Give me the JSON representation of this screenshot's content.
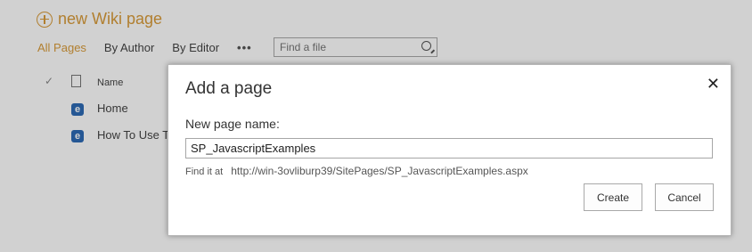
{
  "background": {
    "new_page_label": "new Wiki page",
    "tabs": [
      "All Pages",
      "By Author",
      "By Editor"
    ],
    "more_label": "•••",
    "search_placeholder": "Find a file",
    "list_header_name": "Name",
    "rows": [
      "Home",
      "How To Use T"
    ]
  },
  "dialog": {
    "title": "Add a page",
    "close_label": "✕",
    "name_label": "New page name:",
    "name_value": "SP_JavascriptExamples",
    "find_it_label": "Find it at",
    "find_it_url": "http://win-3ovliburp39/SitePages/SP_JavascriptExamples.aspx",
    "create_label": "Create",
    "cancel_label": "Cancel"
  },
  "colors": {
    "accent": "#d89b3a",
    "overlay": "#d2d2d2"
  }
}
